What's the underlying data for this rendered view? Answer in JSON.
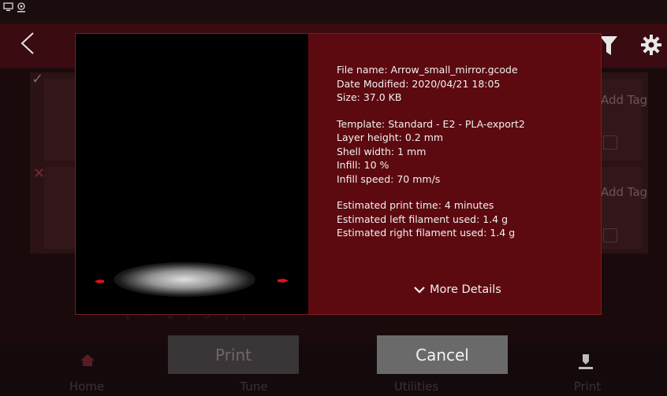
{
  "status_bar": {
    "icons": [
      "monitor-icon",
      "webcam-icon"
    ]
  },
  "header": {
    "icons": [
      "back-chevron-icon",
      "filter-icon",
      "gear-icon"
    ]
  },
  "background_list": {
    "rows": [
      {
        "checked": true,
        "tag_label": "Add Tag"
      },
      {
        "checked": true,
        "tag_label": "Add Tag"
      }
    ],
    "faint_text": "[ — 2 , 5  ] ]"
  },
  "modal": {
    "file_info": {
      "file_name": "File name: Arrow_small_mirror.gcode",
      "date_modified": "Date Modified: 2020/04/21 18:05",
      "size": "Size: 37.0 KB"
    },
    "template_info": {
      "template": "Template: Standard - E2 - PLA-export2",
      "layer_height": "Layer height: 0.2 mm",
      "shell_width": "Shell width: 1 mm",
      "infill": "Infill: 10 %",
      "infill_speed": "Infill speed: 70 mm/s"
    },
    "estimates": {
      "print_time": "Estimated print time: 4 minutes",
      "left_filament": "Estimated left filament used: 1.4 g",
      "right_filament": "Estimated right filament used: 1.4 g"
    },
    "more_details": "More Details"
  },
  "buttons": {
    "print": "Print",
    "cancel": "Cancel"
  },
  "bottom_nav": {
    "home": "Home",
    "tune": "Tune",
    "utilities": "Utilities",
    "print": "Print"
  },
  "colors": {
    "modal_bg": "#5c0a10",
    "header_bg": "#3a0b11",
    "preview_bg": "#000000",
    "cancel_bg": "#6a6a6a",
    "print_disabled_bg": "#3a3637",
    "model_red": "#d4141b"
  }
}
